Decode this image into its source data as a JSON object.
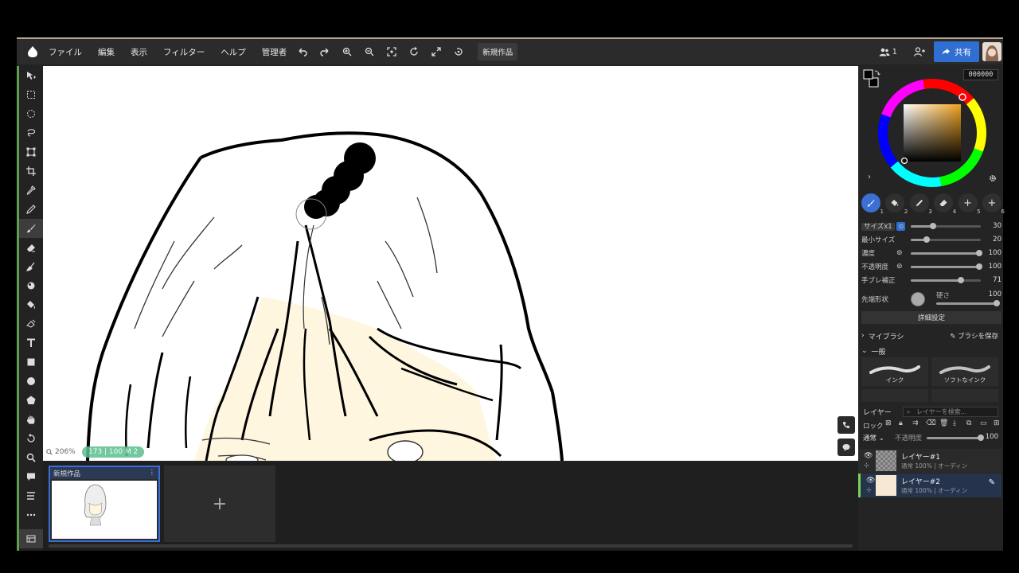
{
  "menubar": {
    "items": [
      "ファイル",
      "編集",
      "表示",
      "フィルター",
      "ヘルプ",
      "管理者"
    ],
    "icons": [
      "undo-icon",
      "redo-icon",
      "zoom-in-icon",
      "zoom-out-icon",
      "fit-icon",
      "rotate-icon",
      "fullscreen-icon",
      "reset-icon"
    ],
    "doc_tab": "新規作品",
    "collaborators": "1",
    "share_label": "共有"
  },
  "toolbar": {
    "tools": [
      "move",
      "rect-select",
      "lasso-select",
      "magic-select",
      "transform",
      "crop",
      "eyedropper",
      "pen",
      "brush",
      "eraser",
      "smudge",
      "blur",
      "fill",
      "gradient",
      "text",
      "shape-rect",
      "shape-circle",
      "shape-star",
      "hand",
      "rotate",
      "zoom",
      "comment",
      "layer-panel",
      "more"
    ],
    "active": "brush"
  },
  "canvas": {
    "zoom": "206%",
    "brush_info": "173 | 100  M 2"
  },
  "docbar": {
    "thumb_title": "新規作品",
    "add_label": "+"
  },
  "color": {
    "hex": "000000",
    "accent": "#2f6fd1"
  },
  "brush_tabs": [
    "1",
    "2",
    "3",
    "4",
    "5",
    "6"
  ],
  "brush_settings": {
    "size_label": "サイズx1",
    "size_value": "30",
    "min_size_label": "最小サイズ",
    "min_size_value": "20",
    "density_label": "濃度",
    "density_value": "100",
    "opacity_label": "不透明度",
    "opacity_value": "100",
    "stabilizer_label": "手ブレ補正",
    "stabilizer_value": "71",
    "tip_label": "先端形状",
    "hardness_label": "硬さ",
    "hardness_value": "100",
    "detail_button": "詳細設定"
  },
  "brushes": {
    "my_brush": "マイブラシ",
    "save_brush": "ブラシを保存",
    "general": "一般",
    "presets": [
      "インク",
      "ソフトなインク"
    ]
  },
  "layers": {
    "title": "レイヤー",
    "search_placeholder": "レイヤーを検索...",
    "lock_label": "ロック",
    "blend_mode": "通常",
    "opacity_label": "不透明度",
    "opacity_value": "100",
    "items": [
      {
        "name": "レイヤー#1",
        "sub": "通常 100% | オーディン"
      },
      {
        "name": "レイヤー#2",
        "sub": "通常 100% | オーディン"
      }
    ]
  }
}
